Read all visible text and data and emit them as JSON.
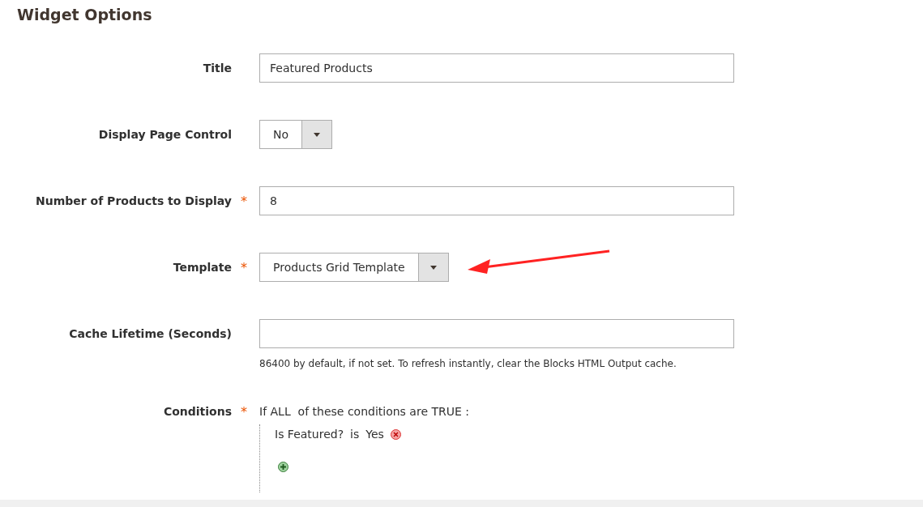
{
  "section": {
    "title": "Widget Options"
  },
  "fields": [
    {
      "kind": "text",
      "label": "Title",
      "value": "Featured Products"
    },
    {
      "kind": "select",
      "label": "Display Page Control",
      "value": "No"
    },
    {
      "kind": "text",
      "label": "Number of Products to Display",
      "asterisk": "*",
      "value": "8"
    },
    {
      "kind": "select",
      "label": "Template",
      "asterisk": "*",
      "value": "Products Grid Template"
    },
    {
      "kind": "text",
      "label": "Cache Lifetime (Seconds)",
      "note": "86400 by default, if not set. To refresh instantly, clear the Blocks HTML Output cache."
    }
  ],
  "conditions": {
    "label": "Conditions",
    "asterisk": "*",
    "prefix": "If",
    "aggregator": "ALL",
    "middle": "of these conditions are",
    "value": "TRUE",
    "suffix": ":",
    "rules": [
      {
        "attribute": "Is Featured?",
        "operator": "is",
        "value": "Yes"
      }
    ]
  }
}
